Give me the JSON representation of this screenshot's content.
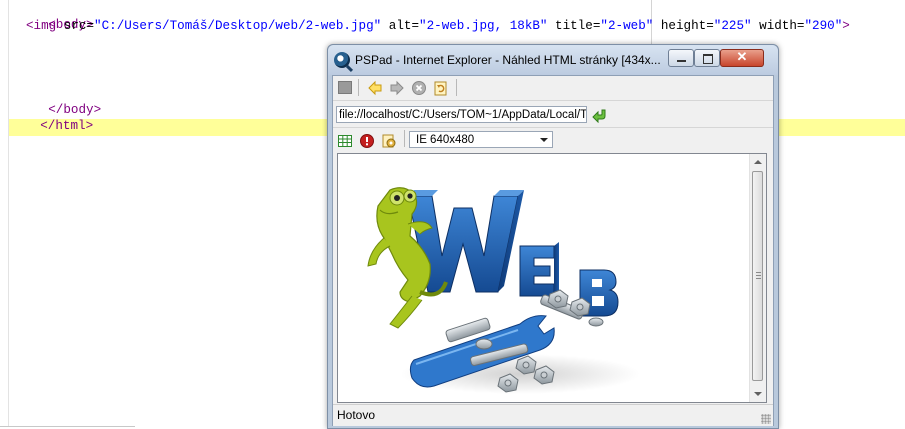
{
  "editor": {
    "lines": {
      "body_open": "<body>",
      "img_tag_open": "<img",
      "src_attr": " src=",
      "src_val": "\"C:/Users/Tomáš/Desktop/web/2-web.jpg\"",
      "alt_attr": " alt=",
      "alt_val": "\"2-web.jpg, 18kB\"",
      "title_attr": " title=",
      "title_val": "\"2-web\"",
      "height_attr": " height=",
      "height_val": "\"225\"",
      "width_attr": " width=",
      "width_val": "\"290\"",
      "img_tag_close": ">",
      "body_close": "</body>",
      "html_close": "</html>"
    }
  },
  "window": {
    "title": "PSPad - Internet Explorer - Náhled HTML stránky   [434x..."
  },
  "toolbar": {
    "url": "file://localhost/C:/Users/TOM~1/AppData/Local/T",
    "size_option": "IE 640x480"
  },
  "status": {
    "text": "Hotovo"
  },
  "content_image": {
    "letters": [
      "W",
      "E",
      "B"
    ]
  },
  "colors": {
    "tag": "#800080",
    "string": "#0000ff",
    "current_line": "#ffff99",
    "web_blue": "#1f5fae",
    "gecko_green": "#a6c21c"
  }
}
